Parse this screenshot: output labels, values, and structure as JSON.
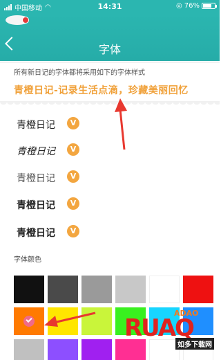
{
  "status_bar": {
    "carrier": "中国移动",
    "time": "14:31",
    "battery": "76%",
    "battery_level": 0.76
  },
  "header": {
    "title": "字体"
  },
  "preview": {
    "hint": "所有新日记的字体都将采用如下的字体样式",
    "sample": "青橙日记-记录生活点滴，珍藏美丽回忆"
  },
  "fonts": [
    {
      "name": "青橙日记",
      "badge": "V"
    },
    {
      "name": "青橙日记",
      "badge": "V"
    },
    {
      "name": "青橙日记",
      "badge": "V"
    },
    {
      "name": "青橙日记",
      "badge": "V"
    },
    {
      "name": "青橙日记",
      "badge": "V"
    }
  ],
  "colors_section": {
    "label": "字体颜色"
  },
  "colors": {
    "row1": [
      "#111111",
      "#4a4a4a",
      "#9a9a9a",
      "#c8c8c8",
      "#ffffff",
      "#ee1111"
    ],
    "row2": [
      "#ff7a00",
      "#ffe600",
      "#c9f53a",
      "#39f01f",
      "#17d5ff",
      "#1f8fff"
    ],
    "row3": [
      "#c0c0c0",
      "#8d4fff",
      "#a020f0",
      "#ff2f93",
      "#ffffff",
      "#ffffff"
    ],
    "selected_index": 0,
    "selected_row": 2
  },
  "watermark": {
    "brand": "RUAQ",
    "tagline": "如多下载网",
    "site": "ADAO"
  }
}
